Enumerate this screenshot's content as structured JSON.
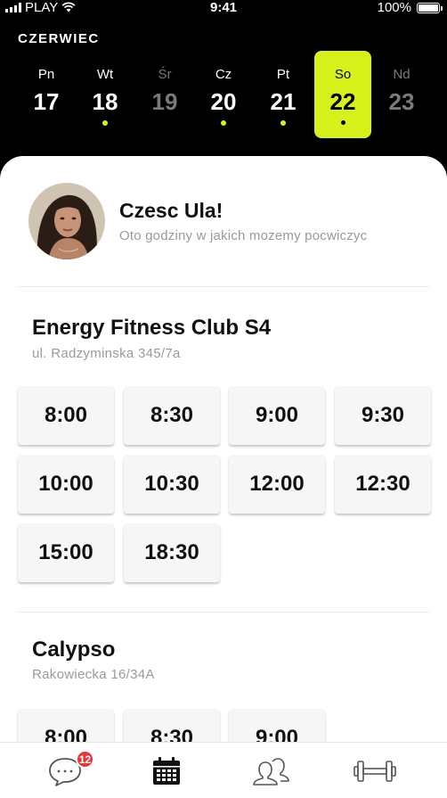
{
  "status_bar": {
    "carrier": "PLAY",
    "time": "9:41",
    "battery": "100%"
  },
  "calendar": {
    "month": "CZERWIEC",
    "days": [
      {
        "name": "Pn",
        "num": "17",
        "state": "normal",
        "dot": false
      },
      {
        "name": "Wt",
        "num": "18",
        "state": "normal",
        "dot": true
      },
      {
        "name": "Śr",
        "num": "19",
        "state": "muted",
        "dot": false
      },
      {
        "name": "Cz",
        "num": "20",
        "state": "normal",
        "dot": true
      },
      {
        "name": "Pt",
        "num": "21",
        "state": "normal",
        "dot": true
      },
      {
        "name": "So",
        "num": "22",
        "state": "selected",
        "dot": true
      },
      {
        "name": "Nd",
        "num": "23",
        "state": "muted",
        "dot": false
      }
    ]
  },
  "greeting": {
    "title": "Czesc Ula!",
    "subtitle": "Oto godziny w jakich mozemy pocwiczyc"
  },
  "clubs": [
    {
      "name": "Energy Fitness Club S4",
      "address": "ul. Radzyminska 345/7a",
      "slots": [
        "8:00",
        "8:30",
        "9:00",
        "9:30",
        "10:00",
        "10:30",
        "12:00",
        "12:30",
        "15:00",
        "18:30"
      ]
    },
    {
      "name": "Calypso",
      "address": "Rakowiecka 16/34A",
      "slots": [
        "8:00",
        "8:30",
        "9:00"
      ]
    }
  ],
  "tabbar": {
    "items": [
      {
        "icon": "chat-icon",
        "badge": "12",
        "active": false
      },
      {
        "icon": "calendar-icon",
        "active": true
      },
      {
        "icon": "people-icon",
        "active": false
      },
      {
        "icon": "dumbbell-icon",
        "active": false
      }
    ]
  },
  "colors": {
    "accent": "#d6f21a",
    "badge": "#e8343a",
    "background": "#000000"
  }
}
